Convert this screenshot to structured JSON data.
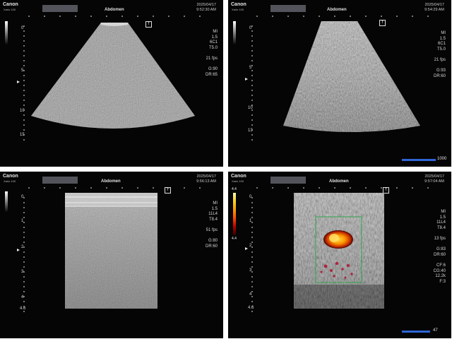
{
  "panels": [
    {
      "brand": "Canon",
      "model": "Xario 100",
      "exam": "Abdomen",
      "date": "2025/04/17",
      "time": "9:52:30 AM",
      "depth_labels": [
        "0",
        "5",
        "10",
        "15"
      ],
      "params": [
        "MI",
        "1.5",
        "6C1",
        "T5.0",
        "",
        "21 fps",
        "",
        "G:90",
        "DR:65"
      ]
    },
    {
      "brand": "Canon",
      "model": "Xario 100",
      "exam": "Abdomen",
      "date": "2025/04/17",
      "time": "9:54:29 AM",
      "depth_labels": [
        "0",
        "5",
        "10",
        "13"
      ],
      "params": [
        "MI",
        "1.5",
        "6C1",
        "T5.0",
        "",
        "21 fps",
        "",
        "G:93",
        "DR:60"
      ],
      "cine_label": "1000"
    },
    {
      "brand": "Canon",
      "model": "Xario 100",
      "exam": "Abdomen",
      "date": "2025/04/17",
      "time": "9:56:13 AM",
      "depth_labels": [
        "0",
        "1",
        "2",
        "3",
        "4",
        "4.6"
      ],
      "params": [
        "MI",
        "1.5",
        "11L4",
        "T8.4",
        "",
        "51 fps",
        "",
        "G:80",
        "DR:60"
      ]
    },
    {
      "brand": "Canon",
      "model": "Xario 100",
      "exam": "Abdomen",
      "date": "2025/04/17",
      "time": "9:57:04 AM",
      "depth_labels": [
        "0",
        "1",
        "2",
        "3",
        "4",
        "4.6"
      ],
      "params": [
        "MI",
        "1.5",
        "11L4",
        "T8.4",
        "",
        "13 fps",
        "",
        "G:83",
        "DR:60",
        "",
        "CF:6",
        "CG:40",
        "12.2k",
        "F:3"
      ],
      "color_scale": {
        "top": "4.4",
        "bottom": "4.4"
      },
      "cine_label": "47"
    }
  ],
  "colors": {
    "panel_bg": "#050505",
    "cine_bar": "#2e66d6",
    "roi_box": "#2fa44a"
  },
  "icons": [
    "trackball-t-icon",
    "focus-marker-icon",
    "grayscale-bar-icon",
    "color-scale-icon"
  ]
}
